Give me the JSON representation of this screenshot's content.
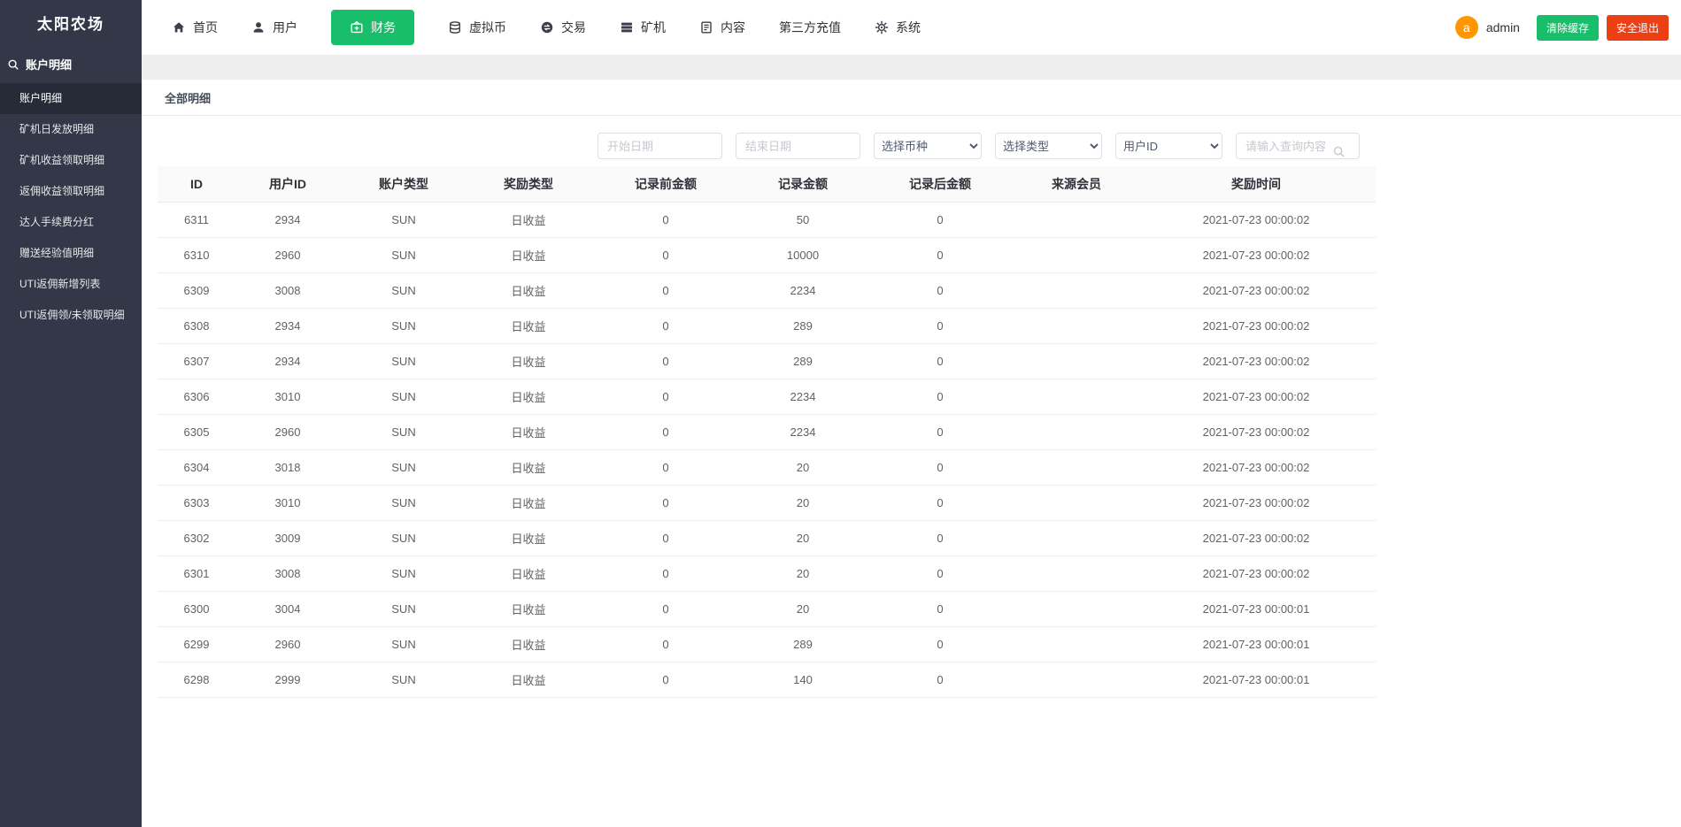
{
  "app": {
    "title": "太阳农场"
  },
  "colors": {
    "primary_green": "#19be6b",
    "danger_red": "#ed3f14",
    "avatar_orange": "#ff9800",
    "sidebar_bg": "#323848",
    "sidebar_active_bg": "#262b38"
  },
  "topnav": {
    "items": [
      {
        "label": "首页",
        "icon": "home-icon",
        "active": false
      },
      {
        "label": "用户",
        "icon": "user-icon",
        "active": false
      },
      {
        "label": "财务",
        "icon": "finance-icon",
        "active": true
      },
      {
        "label": "虚拟币",
        "icon": "coin-icon",
        "active": false
      },
      {
        "label": "交易",
        "icon": "trade-icon",
        "active": false
      },
      {
        "label": "矿机",
        "icon": "miner-icon",
        "active": false
      },
      {
        "label": "内容",
        "icon": "content-icon",
        "active": false
      },
      {
        "label": "第三方充值",
        "icon": null,
        "active": false
      },
      {
        "label": "系统",
        "icon": "gear-icon",
        "active": false
      }
    ],
    "user": {
      "avatar_letter": "a",
      "name": "admin"
    },
    "clear_cache_label": "清除缓存",
    "logout_label": "安全退出"
  },
  "sidebar": {
    "section": "账户明细",
    "active_index": 0,
    "items": [
      "账户明细",
      "矿机日发放明细",
      "矿机收益领取明细",
      "返佣收益领取明细",
      "达人手续费分红",
      "赠送经验值明细",
      "UTI返佣新增列表",
      "UTI返佣领/未领取明细"
    ]
  },
  "content": {
    "tab": "全部明细",
    "filters": {
      "start_date_placeholder": "开始日期",
      "end_date_placeholder": "结束日期",
      "coin_select": "选择币种",
      "type_select": "选择类型",
      "user_select": "用户ID",
      "search_placeholder": "请输入查询内容"
    },
    "table": {
      "headers": [
        "ID",
        "用户ID",
        "账户类型",
        "奖励类型",
        "记录前金额",
        "记录金额",
        "记录后金额",
        "来源会员",
        "奖励时间"
      ],
      "rows": [
        [
          "6311",
          "2934",
          "SUN",
          "日收益",
          "0",
          "50",
          "0",
          "",
          "2021-07-23 00:00:02"
        ],
        [
          "6310",
          "2960",
          "SUN",
          "日收益",
          "0",
          "10000",
          "0",
          "",
          "2021-07-23 00:00:02"
        ],
        [
          "6309",
          "3008",
          "SUN",
          "日收益",
          "0",
          "2234",
          "0",
          "",
          "2021-07-23 00:00:02"
        ],
        [
          "6308",
          "2934",
          "SUN",
          "日收益",
          "0",
          "289",
          "0",
          "",
          "2021-07-23 00:00:02"
        ],
        [
          "6307",
          "2934",
          "SUN",
          "日收益",
          "0",
          "289",
          "0",
          "",
          "2021-07-23 00:00:02"
        ],
        [
          "6306",
          "3010",
          "SUN",
          "日收益",
          "0",
          "2234",
          "0",
          "",
          "2021-07-23 00:00:02"
        ],
        [
          "6305",
          "2960",
          "SUN",
          "日收益",
          "0",
          "2234",
          "0",
          "",
          "2021-07-23 00:00:02"
        ],
        [
          "6304",
          "3018",
          "SUN",
          "日收益",
          "0",
          "20",
          "0",
          "",
          "2021-07-23 00:00:02"
        ],
        [
          "6303",
          "3010",
          "SUN",
          "日收益",
          "0",
          "20",
          "0",
          "",
          "2021-07-23 00:00:02"
        ],
        [
          "6302",
          "3009",
          "SUN",
          "日收益",
          "0",
          "20",
          "0",
          "",
          "2021-07-23 00:00:02"
        ],
        [
          "6301",
          "3008",
          "SUN",
          "日收益",
          "0",
          "20",
          "0",
          "",
          "2021-07-23 00:00:02"
        ],
        [
          "6300",
          "3004",
          "SUN",
          "日收益",
          "0",
          "20",
          "0",
          "",
          "2021-07-23 00:00:01"
        ],
        [
          "6299",
          "2960",
          "SUN",
          "日收益",
          "0",
          "289",
          "0",
          "",
          "2021-07-23 00:00:01"
        ],
        [
          "6298",
          "2999",
          "SUN",
          "日收益",
          "0",
          "140",
          "0",
          "",
          "2021-07-23 00:00:01"
        ]
      ]
    }
  }
}
